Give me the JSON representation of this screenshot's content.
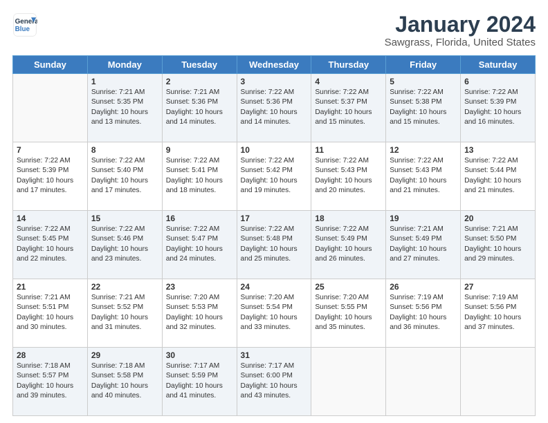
{
  "logo": {
    "name1": "General",
    "name2": "Blue"
  },
  "title": "January 2024",
  "subtitle": "Sawgrass, Florida, United States",
  "weekdays": [
    "Sunday",
    "Monday",
    "Tuesday",
    "Wednesday",
    "Thursday",
    "Friday",
    "Saturday"
  ],
  "weeks": [
    [
      {
        "day": "",
        "info": ""
      },
      {
        "day": "1",
        "info": "Sunrise: 7:21 AM\nSunset: 5:35 PM\nDaylight: 10 hours\nand 13 minutes."
      },
      {
        "day": "2",
        "info": "Sunrise: 7:21 AM\nSunset: 5:36 PM\nDaylight: 10 hours\nand 14 minutes."
      },
      {
        "day": "3",
        "info": "Sunrise: 7:22 AM\nSunset: 5:36 PM\nDaylight: 10 hours\nand 14 minutes."
      },
      {
        "day": "4",
        "info": "Sunrise: 7:22 AM\nSunset: 5:37 PM\nDaylight: 10 hours\nand 15 minutes."
      },
      {
        "day": "5",
        "info": "Sunrise: 7:22 AM\nSunset: 5:38 PM\nDaylight: 10 hours\nand 15 minutes."
      },
      {
        "day": "6",
        "info": "Sunrise: 7:22 AM\nSunset: 5:39 PM\nDaylight: 10 hours\nand 16 minutes."
      }
    ],
    [
      {
        "day": "7",
        "info": "Sunrise: 7:22 AM\nSunset: 5:39 PM\nDaylight: 10 hours\nand 17 minutes."
      },
      {
        "day": "8",
        "info": "Sunrise: 7:22 AM\nSunset: 5:40 PM\nDaylight: 10 hours\nand 17 minutes."
      },
      {
        "day": "9",
        "info": "Sunrise: 7:22 AM\nSunset: 5:41 PM\nDaylight: 10 hours\nand 18 minutes."
      },
      {
        "day": "10",
        "info": "Sunrise: 7:22 AM\nSunset: 5:42 PM\nDaylight: 10 hours\nand 19 minutes."
      },
      {
        "day": "11",
        "info": "Sunrise: 7:22 AM\nSunset: 5:43 PM\nDaylight: 10 hours\nand 20 minutes."
      },
      {
        "day": "12",
        "info": "Sunrise: 7:22 AM\nSunset: 5:43 PM\nDaylight: 10 hours\nand 21 minutes."
      },
      {
        "day": "13",
        "info": "Sunrise: 7:22 AM\nSunset: 5:44 PM\nDaylight: 10 hours\nand 21 minutes."
      }
    ],
    [
      {
        "day": "14",
        "info": "Sunrise: 7:22 AM\nSunset: 5:45 PM\nDaylight: 10 hours\nand 22 minutes."
      },
      {
        "day": "15",
        "info": "Sunrise: 7:22 AM\nSunset: 5:46 PM\nDaylight: 10 hours\nand 23 minutes."
      },
      {
        "day": "16",
        "info": "Sunrise: 7:22 AM\nSunset: 5:47 PM\nDaylight: 10 hours\nand 24 minutes."
      },
      {
        "day": "17",
        "info": "Sunrise: 7:22 AM\nSunset: 5:48 PM\nDaylight: 10 hours\nand 25 minutes."
      },
      {
        "day": "18",
        "info": "Sunrise: 7:22 AM\nSunset: 5:49 PM\nDaylight: 10 hours\nand 26 minutes."
      },
      {
        "day": "19",
        "info": "Sunrise: 7:21 AM\nSunset: 5:49 PM\nDaylight: 10 hours\nand 27 minutes."
      },
      {
        "day": "20",
        "info": "Sunrise: 7:21 AM\nSunset: 5:50 PM\nDaylight: 10 hours\nand 29 minutes."
      }
    ],
    [
      {
        "day": "21",
        "info": "Sunrise: 7:21 AM\nSunset: 5:51 PM\nDaylight: 10 hours\nand 30 minutes."
      },
      {
        "day": "22",
        "info": "Sunrise: 7:21 AM\nSunset: 5:52 PM\nDaylight: 10 hours\nand 31 minutes."
      },
      {
        "day": "23",
        "info": "Sunrise: 7:20 AM\nSunset: 5:53 PM\nDaylight: 10 hours\nand 32 minutes."
      },
      {
        "day": "24",
        "info": "Sunrise: 7:20 AM\nSunset: 5:54 PM\nDaylight: 10 hours\nand 33 minutes."
      },
      {
        "day": "25",
        "info": "Sunrise: 7:20 AM\nSunset: 5:55 PM\nDaylight: 10 hours\nand 35 minutes."
      },
      {
        "day": "26",
        "info": "Sunrise: 7:19 AM\nSunset: 5:56 PM\nDaylight: 10 hours\nand 36 minutes."
      },
      {
        "day": "27",
        "info": "Sunrise: 7:19 AM\nSunset: 5:56 PM\nDaylight: 10 hours\nand 37 minutes."
      }
    ],
    [
      {
        "day": "28",
        "info": "Sunrise: 7:18 AM\nSunset: 5:57 PM\nDaylight: 10 hours\nand 39 minutes."
      },
      {
        "day": "29",
        "info": "Sunrise: 7:18 AM\nSunset: 5:58 PM\nDaylight: 10 hours\nand 40 minutes."
      },
      {
        "day": "30",
        "info": "Sunrise: 7:17 AM\nSunset: 5:59 PM\nDaylight: 10 hours\nand 41 minutes."
      },
      {
        "day": "31",
        "info": "Sunrise: 7:17 AM\nSunset: 6:00 PM\nDaylight: 10 hours\nand 43 minutes."
      },
      {
        "day": "",
        "info": ""
      },
      {
        "day": "",
        "info": ""
      },
      {
        "day": "",
        "info": ""
      }
    ]
  ]
}
